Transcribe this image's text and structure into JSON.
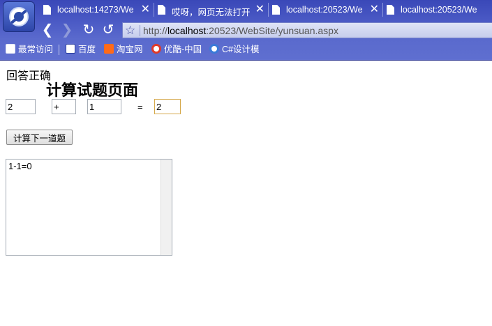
{
  "browser": {
    "tabs": [
      {
        "title": "localhost:14273/We"
      },
      {
        "title": "哎呀，网页无法打开"
      },
      {
        "title": "localhost:20523/We"
      },
      {
        "title": "localhost:20523/We"
      }
    ],
    "close_glyph": "✕",
    "address": {
      "scheme": "http://",
      "host": "localhost",
      "rest": ":20523/WebSite/yunsuan.aspx"
    },
    "bookmarks": [
      {
        "label": "最常访问",
        "icon": "folder-icon"
      },
      {
        "label": "百度",
        "icon": "baidu-icon"
      },
      {
        "label": "淘宝网",
        "icon": "taobao-icon"
      },
      {
        "label": "优酷-中国",
        "icon": "youku-icon"
      },
      {
        "label": "C#设计模",
        "icon": "csharp-icon"
      }
    ],
    "accent_color": "#4958c4"
  },
  "page": {
    "result_text": "回答正确",
    "title": "计算试题页面",
    "operand1": "2",
    "operator": "+",
    "operand2": "1",
    "equals": "=",
    "answer": "2",
    "next_button": "计算下一道题",
    "history": "1-1=0"
  }
}
